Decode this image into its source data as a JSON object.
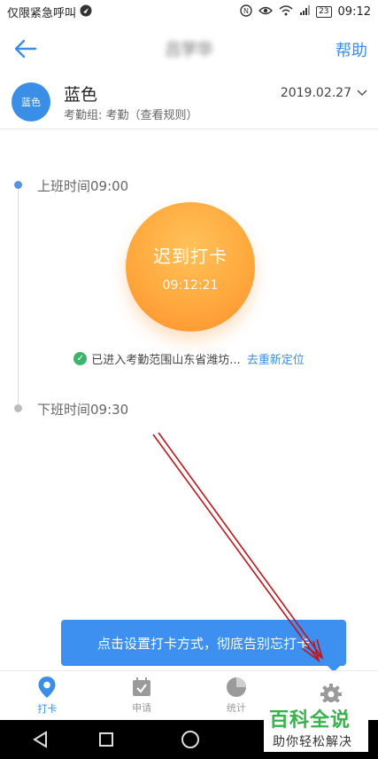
{
  "status_bar": {
    "carrier_text": "仅限紧急呼叫",
    "battery": "23",
    "time": "09:12"
  },
  "header": {
    "back_icon": "arrow-left-icon",
    "title": "吕学华",
    "help_label": "帮助"
  },
  "user": {
    "avatar_text": "蓝色",
    "name": "蓝色",
    "group_text": "考勤组: 考勤（查看规则）",
    "date": "2019.02.27"
  },
  "attendance": {
    "clock_in_label": "上班时间09:00",
    "clock_out_label": "下班时间09:30",
    "punch_button_label": "迟到打卡",
    "punch_time": "09:12:21",
    "location_text": "已进入考勤范围山东省潍坊...",
    "relocate_link": "去重新定位"
  },
  "tooltip": {
    "text": "点击设置打卡方式，彻底告别忘打卡"
  },
  "tabs": [
    {
      "label": "打卡",
      "icon": "location-pin-icon",
      "active": true
    },
    {
      "label": "申请",
      "icon": "calendar-check-icon",
      "active": false
    },
    {
      "label": "统计",
      "icon": "pie-chart-icon",
      "active": false
    },
    {
      "label": "",
      "icon": "gear-icon",
      "active": false
    }
  ],
  "watermark": {
    "title": "百科全说",
    "subtitle": "助你轻松解决"
  },
  "colors": {
    "accent": "#3a8ee6",
    "punch_orange": "#ffa93d",
    "success_green": "#3cb56a",
    "annotation_red": "#c0151b"
  }
}
